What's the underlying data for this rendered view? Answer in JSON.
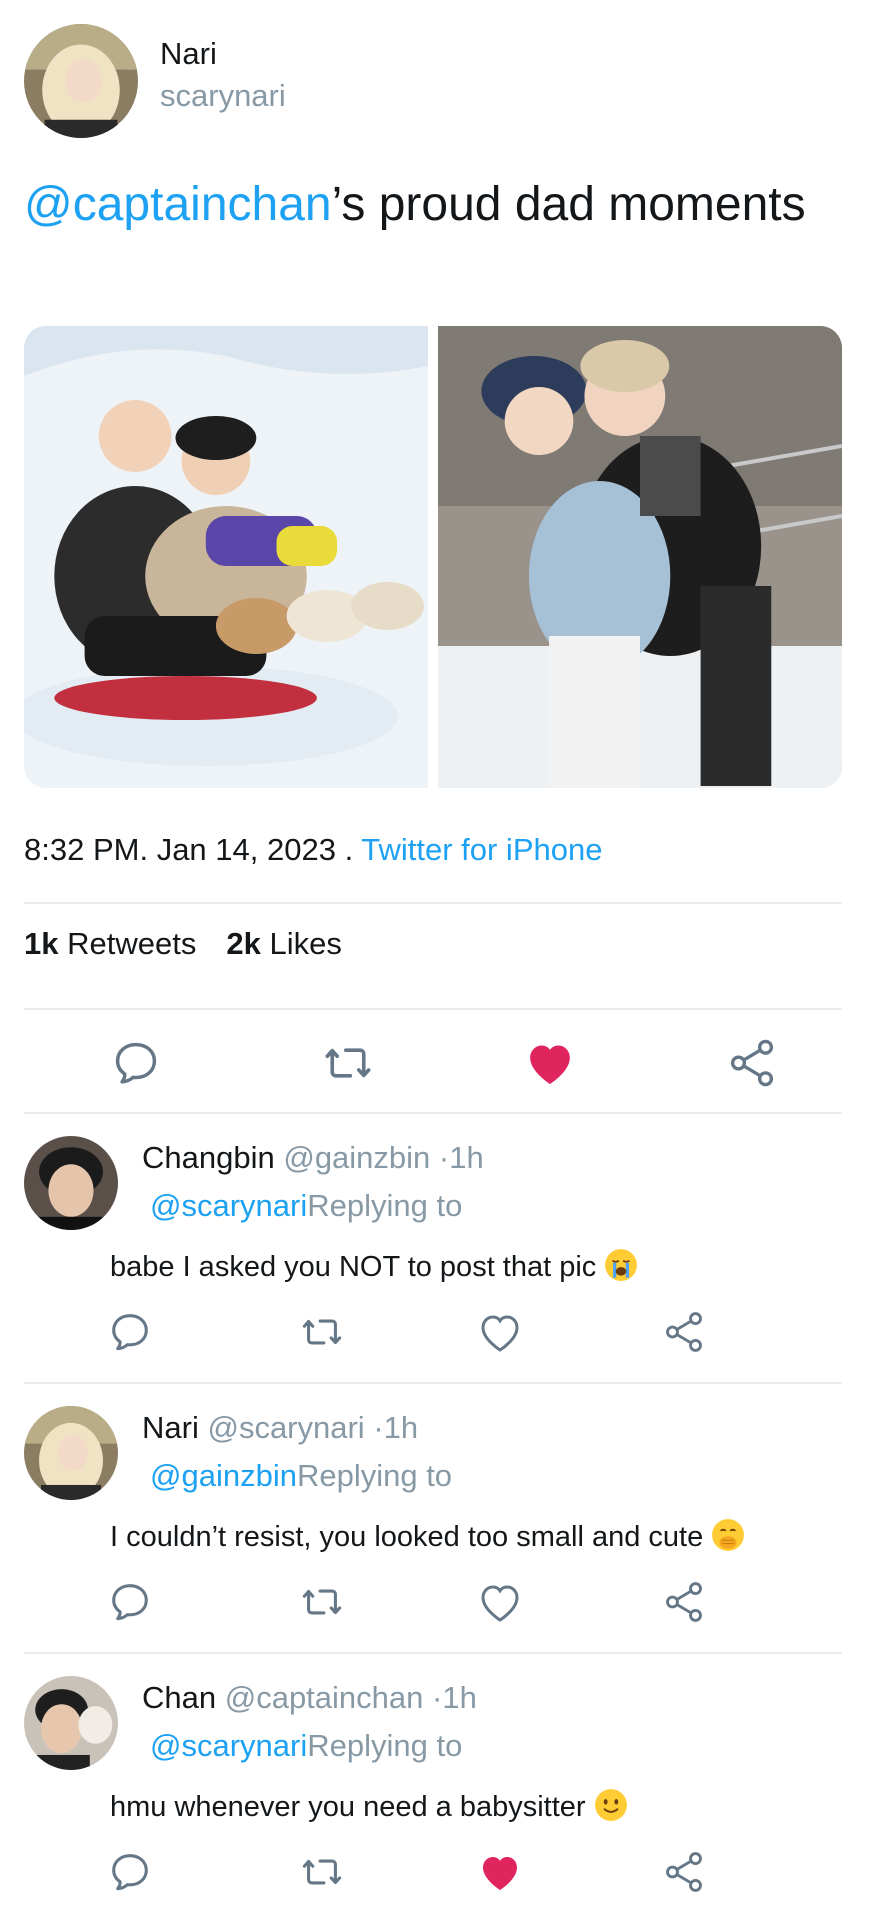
{
  "tweet": {
    "author_name": "Nari",
    "author_handle": "scarynari",
    "text_mention": "@captainchan",
    "text_rest": "’s proud dad moments",
    "time": "8:32 PM",
    "date": "Jan 14, 2023",
    "source": "Twitter for iPhone",
    "retweets_count": "1k",
    "retweets_label": "Retweets",
    "likes_count": "2k",
    "likes_label": "Likes"
  },
  "icons": {
    "reply": "reply-icon",
    "retweet": "retweet-icon",
    "like": "heart-icon",
    "share": "share-icon"
  },
  "colors": {
    "accent": "#1da1f2",
    "liked": "#e0245e",
    "muted": "#8899a6",
    "divider": "#e6ecf0"
  },
  "replies": [
    {
      "name": "Changbin",
      "handle": "@gainzbin",
      "time": "·1h",
      "replying_handle": "@scarynari",
      "replying_label": "Replying to",
      "text": "babe I asked you NOT to post that pic",
      "emoji": "loudly-crying-face",
      "liked": false
    },
    {
      "name": "Nari",
      "handle": "@scarynari",
      "time": "·1h",
      "replying_handle": "@gainzbin",
      "replying_label": "Replying to",
      "text": "I couldn’t resist, you looked too small and cute",
      "emoji": "hand-over-mouth-face",
      "liked": false
    },
    {
      "name": "Chan",
      "handle": "@captainchan",
      "time": "·1h",
      "replying_handle": "@scarynari",
      "replying_label": "Replying to",
      "text": "hmu whenever you need a babysitter",
      "emoji": "slightly-smiling-face",
      "liked": true
    }
  ]
}
